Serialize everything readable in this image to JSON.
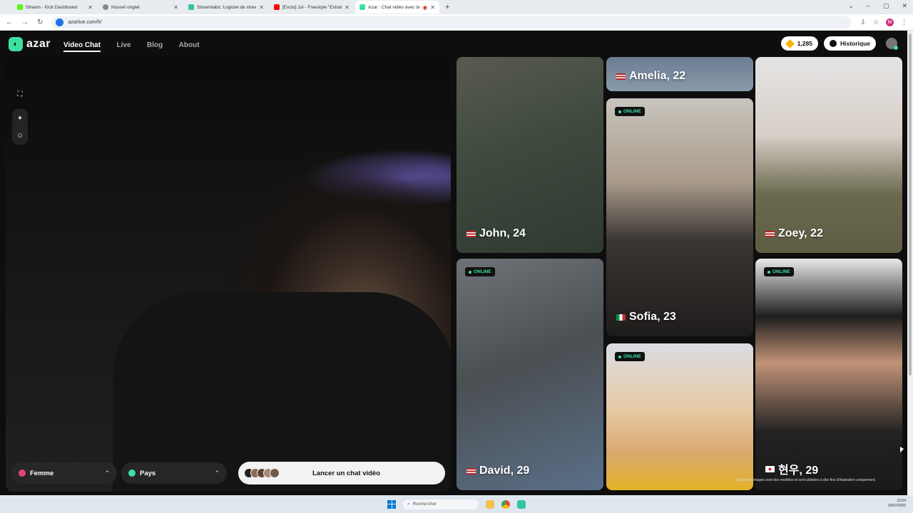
{
  "browser": {
    "tabs": [
      {
        "title": "Stream - Kick Dashboard",
        "color": "#53fc18"
      },
      {
        "title": "Nouvel onglet",
        "color": "#888888"
      },
      {
        "title": "Streamlabs: Logiciel de stream...",
        "color": "#31c3a2"
      },
      {
        "title": "[Exclu] Jul - Freestyle \"Extraterr...",
        "color": "#ff0000"
      },
      {
        "title": "Azar : Chat vidéo avec de n...",
        "color": "#3de0a1"
      }
    ],
    "url": "azarlive.com/fr/"
  },
  "header": {
    "logo": "azar",
    "menu": [
      "Video Chat",
      "Live",
      "Blog",
      "About"
    ],
    "gems": "1,285",
    "history": "Historique"
  },
  "filters": {
    "gender": "Femme",
    "country": "Pays"
  },
  "launch_label": "Lancer un chat vidéo",
  "cards": [
    {
      "name": "John, 24",
      "online": false,
      "flag": "us"
    },
    {
      "name": "David, 29",
      "online": true,
      "flag": "us"
    },
    {
      "name": "Amelia, 22",
      "online": false,
      "flag": "us"
    },
    {
      "name": "Sofia, 23",
      "online": true,
      "flag": "it"
    },
    {
      "name": "",
      "online": true,
      "flag": ""
    },
    {
      "name": "Zoey, 22",
      "online": false,
      "flag": "us"
    },
    {
      "name": "현우, 29",
      "online": true,
      "flag": "kr"
    }
  ],
  "online_label": "ONLINE",
  "disclaimer": "Toutes les images sont des modèles et sont utilisées à des fins d'illustration uniquement.",
  "taskbar": {
    "search": "Rechercher",
    "time": "23:54",
    "date": "20/07/2025"
  }
}
